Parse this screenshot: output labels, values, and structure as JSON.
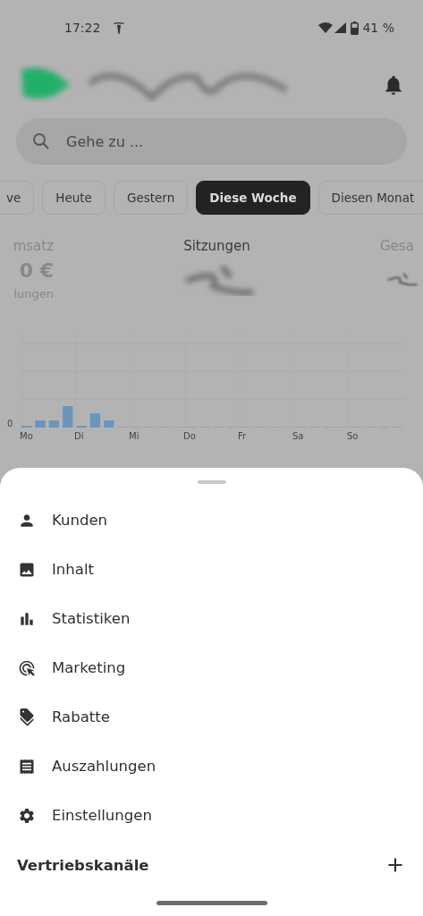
{
  "status_bar": {
    "time": "17:22",
    "battery": "41 %"
  },
  "search": {
    "placeholder": "Gehe zu ..."
  },
  "period_chips": [
    {
      "label": "ve",
      "selected": false
    },
    {
      "label": "Heute",
      "selected": false
    },
    {
      "label": "Gestern",
      "selected": false
    },
    {
      "label": "Diese Woche",
      "selected": true
    },
    {
      "label": "Diesen Monat",
      "selected": false
    }
  ],
  "stats": [
    {
      "label": "msatz",
      "value": "0 €",
      "caption": "lungen",
      "selected": false
    },
    {
      "label": "Sitzungen",
      "selected": true
    },
    {
      "label": "Gesa",
      "selected": false
    }
  ],
  "chart": {
    "y_tick": "0",
    "days": [
      "Mo",
      "Di",
      "Mi",
      "Do",
      "Fr",
      "Sa",
      "So"
    ]
  },
  "menu": {
    "items": [
      {
        "label": "Kunden"
      },
      {
        "label": "Inhalt"
      },
      {
        "label": "Statistiken"
      },
      {
        "label": "Marketing"
      },
      {
        "label": "Rabatte"
      },
      {
        "label": "Auszahlungen"
      },
      {
        "label": "Einstellungen"
      }
    ],
    "section": {
      "title": "Vertriebskanäle"
    }
  }
}
